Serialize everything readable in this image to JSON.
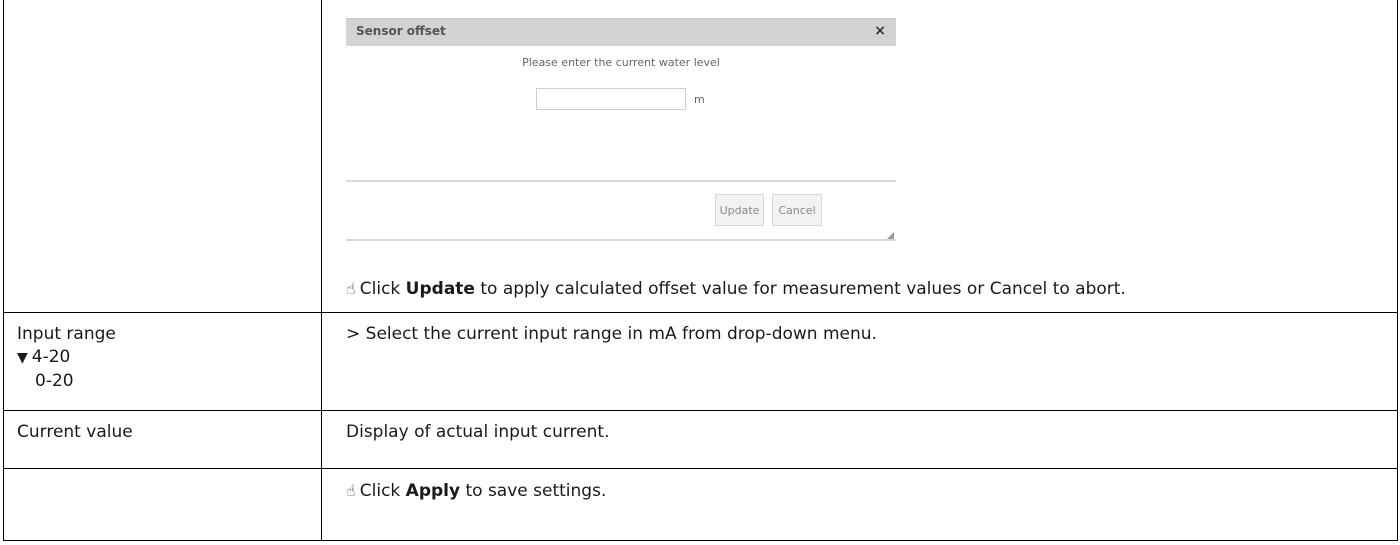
{
  "dialog": {
    "title": "Sensor offset",
    "close_glyph": "×",
    "prompt": "Please enter the current water level",
    "input_value": "",
    "unit": "m",
    "update_label": "Update",
    "cancel_label": "Cancel"
  },
  "row1": {
    "icon": "pointing-hand-icon",
    "pre": "Click ",
    "bold": "Update",
    "post": " to apply calculated offset value for measurement values or Cancel to abort."
  },
  "row2": {
    "label": "Input range",
    "options": [
      "4-20",
      "0-20"
    ],
    "description": "> Select the current input range in mA from drop-down menu."
  },
  "row3": {
    "label": "Current value",
    "description": "Display of actual input current."
  },
  "row4": {
    "pre": "Click ",
    "bold": "Apply",
    "post": " to save settings."
  }
}
